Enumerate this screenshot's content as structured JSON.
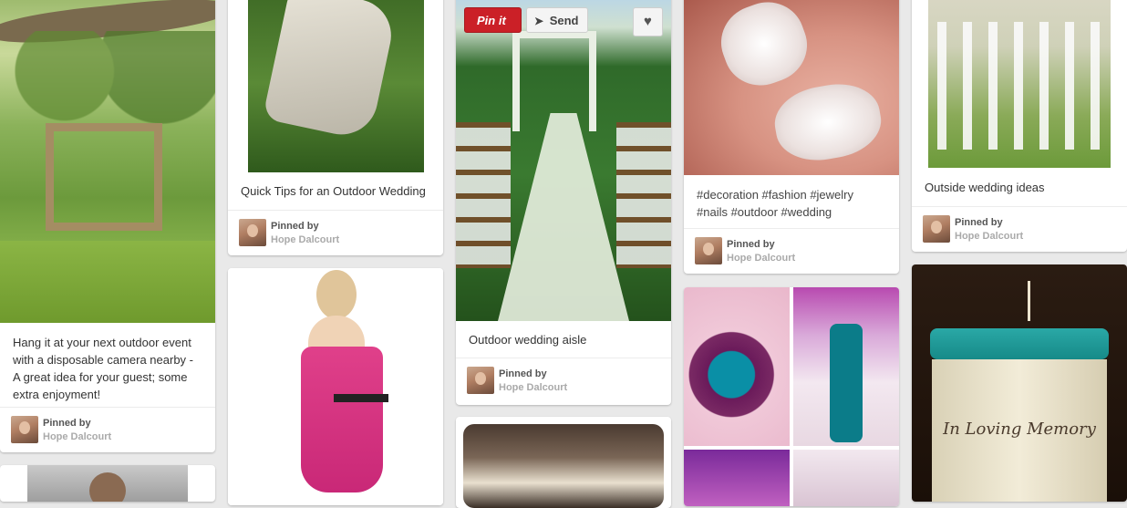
{
  "actions": {
    "pinit_label": "Pin it",
    "send_label": "Send"
  },
  "pins": [
    {
      "description": "Hang it at your next outdoor event with a disposable camera nearby - A great idea for your guest; some extra enjoyment!",
      "pinned_by_label": "Pinned by",
      "user": "Hope Dalcourt"
    },
    {
      "description": "Quick Tips for an Outdoor Wedding",
      "pinned_by_label": "Pinned by",
      "user": "Hope Dalcourt"
    },
    {
      "description": "Outdoor wedding aisle",
      "pinned_by_label": "Pinned by",
      "user": "Hope Dalcourt"
    },
    {
      "description": "#decoration #fashion #jewelry #nails #outdoor #wedding",
      "pinned_by_label": "Pinned by",
      "user": "Hope Dalcourt"
    },
    {
      "description": "Outside wedding ideas",
      "pinned_by_label": "Pinned by",
      "user": "Hope Dalcourt"
    }
  ],
  "candle_text": "In Loving Memory"
}
